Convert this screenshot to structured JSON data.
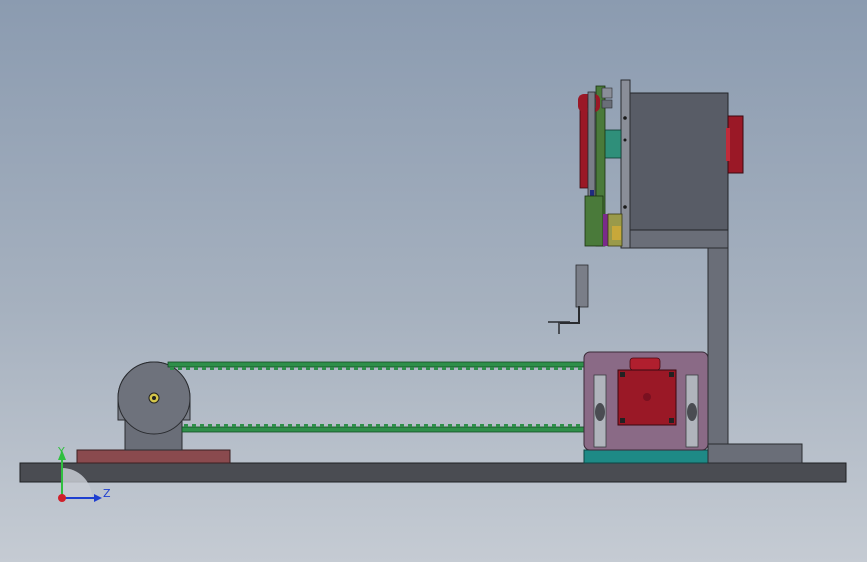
{
  "triad": {
    "y_label": "Y",
    "z_label": "Z",
    "y_color": "#2fbf3f",
    "z_color": "#1f3fd0",
    "origin_color": "#d0202a"
  },
  "colors": {
    "background_top": "#8b9bb0",
    "background_bottom": "#c5cbd3",
    "base_plate": "#4a4c52",
    "steel": "#6a6e78",
    "red_part": "#9a1826",
    "belt": "#2f8f4a",
    "motor_housing": "#8a6a86",
    "teal_plate": "#1e8a86",
    "brown_pad": "#8a4a4e"
  }
}
